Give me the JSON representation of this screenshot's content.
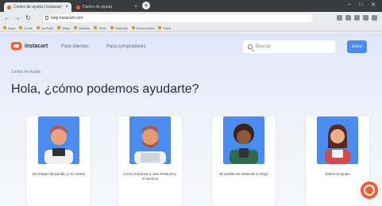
{
  "browser": {
    "tabs": [
      {
        "title": "Centro de ayuda | Instacart"
      },
      {
        "title": "Centro de ayuda"
      }
    ],
    "new_tab": "+",
    "window_controls": [
      "–",
      "□",
      "✕"
    ],
    "address": "help.instacart.com",
    "bookmarks": [
      "Apps",
      "Gmail",
      "YouTube",
      "Maps",
      "Noticias",
      "Drive",
      "Calendar",
      "Documentos",
      "Fotos"
    ]
  },
  "site": {
    "logo": "instacart",
    "nav": [
      "Para clientes",
      "Para compradores"
    ],
    "search_placeholder": "Buscar",
    "login_label": "Entrar",
    "breadcrumb": "Centro de Ayuda",
    "hero_title": "Hola, ¿cómo podemos ayudarte?",
    "cards": [
      {
        "label": "Mi cheque de pedido y mi cuenta"
      },
      {
        "label": "Cómo empezar a usar Instacart y el servicio"
      },
      {
        "label": "Mi pedido de Instacart no llegó"
      },
      {
        "label": "Sobre el equipo"
      }
    ]
  },
  "colors": {
    "accent": "#ff5a35",
    "primary_button": "#4a8cf0",
    "illustration_bg": "#4a8cf0"
  }
}
